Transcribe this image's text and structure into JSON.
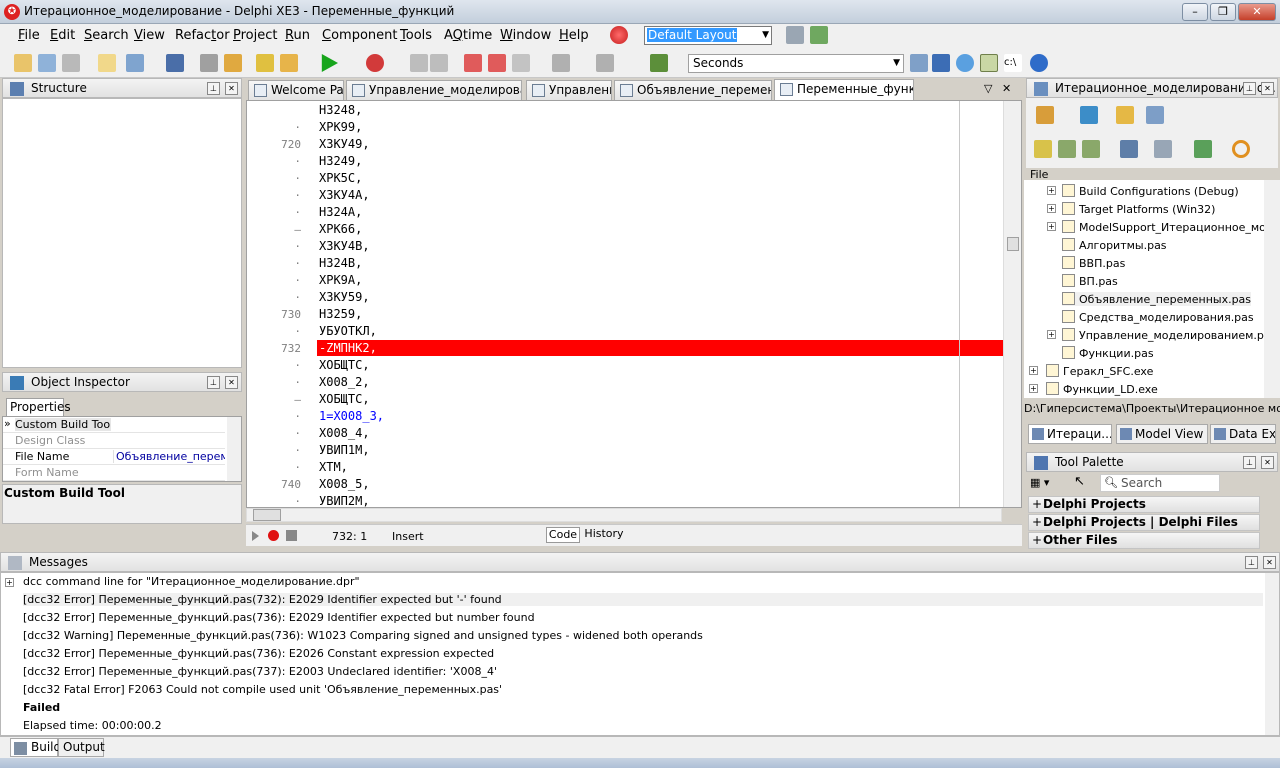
{
  "window": {
    "title": "Итерационное_моделирование - Delphi XE3 - Переменные_функций"
  },
  "menu": [
    {
      "pre": "",
      "u": "F",
      "post": "ile"
    },
    {
      "pre": "",
      "u": "E",
      "post": "dit"
    },
    {
      "pre": "",
      "u": "S",
      "post": "earch"
    },
    {
      "pre": "",
      "u": "V",
      "post": "iew"
    },
    {
      "pre": "Refac",
      "u": "t",
      "post": "or"
    },
    {
      "pre": "",
      "u": "P",
      "post": "roject"
    },
    {
      "pre": "",
      "u": "R",
      "post": "un"
    },
    {
      "pre": "",
      "u": "C",
      "post": "omponent"
    },
    {
      "pre": "",
      "u": "T",
      "post": "ools"
    },
    {
      "pre": "A",
      "u": "Q",
      "post": "time"
    },
    {
      "pre": "",
      "u": "W",
      "post": "indow"
    },
    {
      "pre": "",
      "u": "H",
      "post": "elp"
    }
  ],
  "layout_select": {
    "value": "Default Layout"
  },
  "units_select": {
    "value": "Seconds"
  },
  "structure": {
    "title": "Structure"
  },
  "object_inspector": {
    "title": "Object Inspector",
    "tab": "Properties",
    "rows": [
      {
        "name": "Custom Build Tool",
        "value": "",
        "style": "selected"
      },
      {
        "name": "Design Class",
        "value": "",
        "style": "dim"
      },
      {
        "name": "File Name",
        "value": "Объявление_перемен",
        "style": "normal"
      },
      {
        "name": "Form Name",
        "value": "",
        "style": "dim"
      }
    ],
    "description": "Custom Build Tool"
  },
  "editor": {
    "tabs": [
      "Welcome Page",
      "Управление_моделированием",
      "Управление",
      "Объявление_переменных",
      "Переменные_функций"
    ],
    "active_tab": 4,
    "lines": [
      {
        "num": "",
        "text": "H3248,"
      },
      {
        "num": "·",
        "text": "XPK99,"
      },
      {
        "num": "720",
        "text": "X3KУ49,"
      },
      {
        "num": "·",
        "text": "H3249,"
      },
      {
        "num": "·",
        "text": "XPK5C,"
      },
      {
        "num": "·",
        "text": "X3KУ4A,"
      },
      {
        "num": "·",
        "text": "H324A,"
      },
      {
        "num": "–",
        "text": "XPK66,"
      },
      {
        "num": "·",
        "text": "X3KУ4B,"
      },
      {
        "num": "·",
        "text": "H324B,"
      },
      {
        "num": "·",
        "text": "XPK9A,"
      },
      {
        "num": "·",
        "text": "X3KУ59,"
      },
      {
        "num": "730",
        "text": "H3259,"
      },
      {
        "num": "·",
        "text": "УБУОТКЛ,"
      },
      {
        "num": "732",
        "text": "-ZМПНК2,"
      },
      {
        "num": "·",
        "text": "XОБЩТС,"
      },
      {
        "num": "·",
        "text": "X008_2,"
      },
      {
        "num": "–",
        "text": "XОБЩТС,"
      },
      {
        "num": "·",
        "text": "1=X008_3,"
      },
      {
        "num": "·",
        "text": "X008_4,"
      },
      {
        "num": "·",
        "text": "УВИП1М,"
      },
      {
        "num": "·",
        "text": "XTM,"
      },
      {
        "num": "740",
        "text": "X008_5,"
      },
      {
        "num": "·",
        "text": "УВИП2М,"
      }
    ],
    "error_line_index": 14,
    "status": {
      "position": "732:  1",
      "mode": "Insert",
      "code_tab": "Code",
      "history_tab": "History"
    }
  },
  "project_manager": {
    "title": "Итерационное_моделирование.d...",
    "file_label": "File",
    "items": [
      {
        "label": "Build Configurations (Debug)",
        "indent": 1,
        "expander": true
      },
      {
        "label": "Target Platforms (Win32)",
        "indent": 1,
        "expander": true
      },
      {
        "label": "ModelSupport_Итерационное_мо...",
        "indent": 1,
        "expander": true
      },
      {
        "label": "Алгоритмы.pas",
        "indent": 1,
        "expander": false
      },
      {
        "label": "BBП.pas",
        "indent": 1,
        "expander": false
      },
      {
        "label": "BП.pas",
        "indent": 1,
        "expander": false
      },
      {
        "label": "Объявление_переменных.pas",
        "indent": 1,
        "expander": false
      },
      {
        "label": "Средства_моделирования.pas",
        "indent": 1,
        "expander": false
      },
      {
        "label": "Управление_моделированием.pas",
        "indent": 1,
        "expander": true
      },
      {
        "label": "Функции.pas",
        "indent": 1,
        "expander": false
      },
      {
        "label": "Геракл_SFC.exe",
        "indent": 0,
        "expander": true
      },
      {
        "label": "Функции_LD.exe",
        "indent": 0,
        "expander": true
      }
    ],
    "path": "D:\\Гиперсистема\\Проекты\\Итерационное моделир",
    "tabs": [
      "Итераци...",
      "Model View",
      "Data Ex..."
    ]
  },
  "tool_palette": {
    "title": "Tool Palette",
    "search_placeholder": "Search",
    "categories": [
      "Delphi Projects",
      "Delphi Projects | Delphi Files",
      "Other Files"
    ]
  },
  "messages": {
    "title": "Messages",
    "lines": [
      {
        "text": "dcc command line for \"Итерационное_моделирование.dpr\"",
        "bold": false
      },
      {
        "text": "[dcc32 Error] Переменные_функций.pas(732): E2029 Identifier expected but '-' found",
        "bold": false
      },
      {
        "text": "[dcc32 Error] Переменные_функций.pas(736): E2029 Identifier expected but number found",
        "bold": false
      },
      {
        "text": "[dcc32 Warning] Переменные_функций.pas(736): W1023 Comparing signed and unsigned types - widened both operands",
        "bold": false
      },
      {
        "text": "[dcc32 Error] Переменные_функций.pas(736): E2026 Constant expression expected",
        "bold": false
      },
      {
        "text": "[dcc32 Error] Переменные_функций.pas(737): E2003 Undeclared identifier: 'X008_4'",
        "bold": false
      },
      {
        "text": "[dcc32 Fatal Error] F2063 Could not compile used unit 'Объявление_переменных.pas'",
        "bold": false
      },
      {
        "text": "Failed",
        "bold": true
      },
      {
        "text": "Elapsed time: 00:00:00.2",
        "bold": false
      }
    ],
    "tabs": [
      "Build",
      "Output"
    ]
  }
}
